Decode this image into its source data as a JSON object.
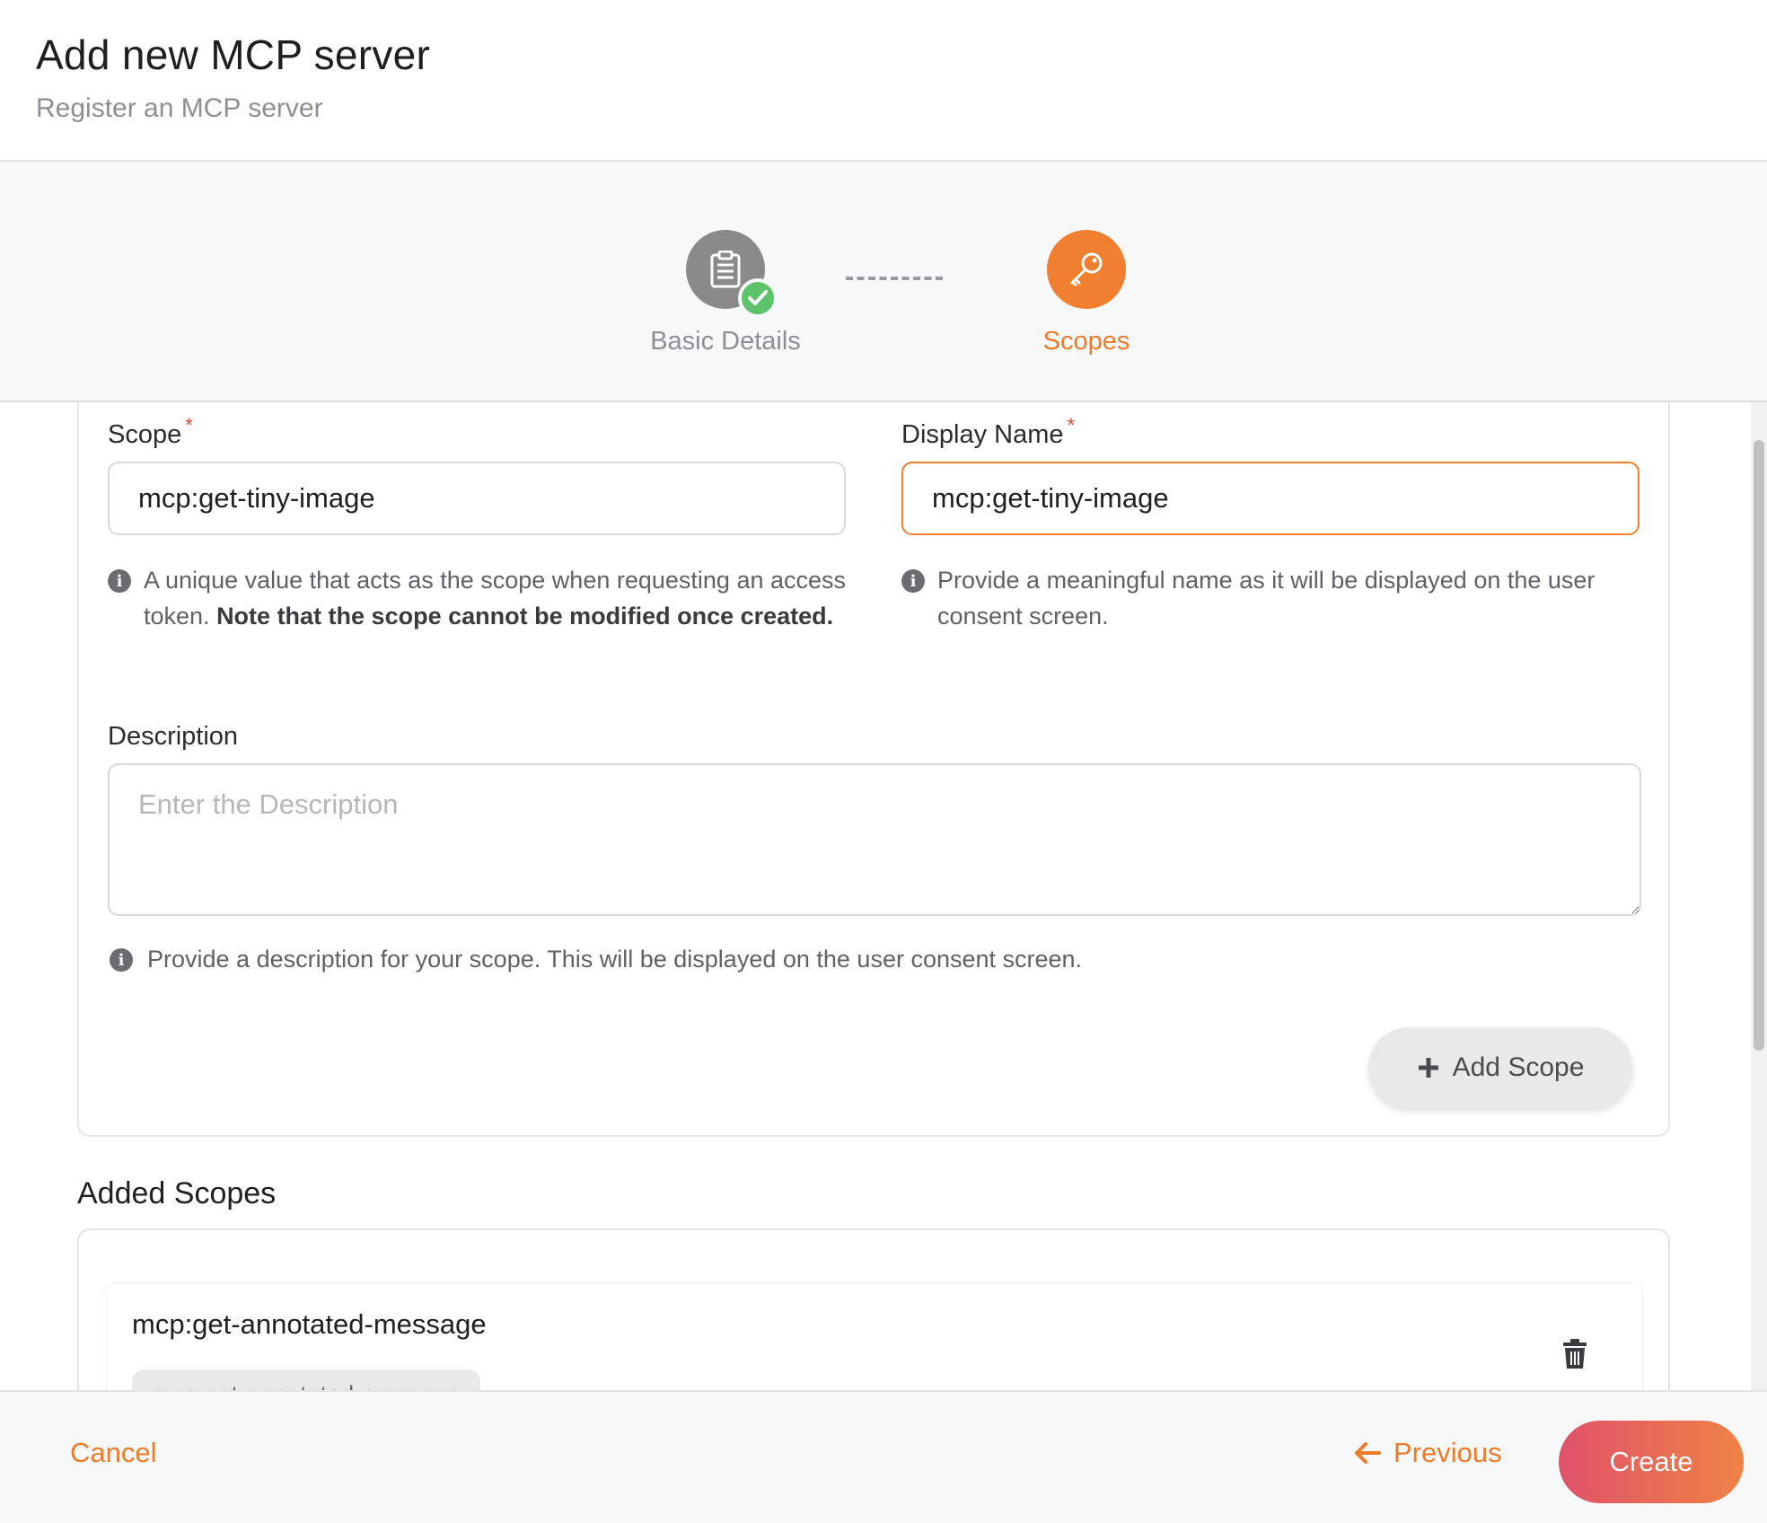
{
  "header": {
    "title": "Add new MCP server",
    "subtitle": "Register an MCP server"
  },
  "stepper": {
    "steps": [
      {
        "label": "Basic Details",
        "state": "completed",
        "icon": "clipboard-icon"
      },
      {
        "label": "Scopes",
        "state": "active",
        "icon": "key-icon"
      }
    ]
  },
  "form": {
    "scope": {
      "label": "Scope",
      "required_mark": "*",
      "value": "mcp:get-tiny-image",
      "help_text": "A unique value that acts as the scope when requesting an access token. ",
      "help_bold": "Note that the scope cannot be modified once created."
    },
    "display_name": {
      "label": "Display Name",
      "required_mark": "*",
      "value": "mcp:get-tiny-image",
      "help_text": "Provide a meaningful name as it will be displayed on the user consent screen."
    },
    "description": {
      "label": "Description",
      "placeholder": "Enter the Description",
      "value": "",
      "help_text": "Provide a description for your scope. This will be displayed on the user consent screen."
    },
    "add_scope_label": "Add Scope"
  },
  "added_scopes": {
    "heading": "Added Scopes",
    "items": [
      {
        "name": "mcp:get-annotated-message",
        "display_name": "mcp:get-annotated-message"
      }
    ]
  },
  "footer": {
    "cancel_label": "Cancel",
    "previous_label": "Previous",
    "create_label": "Create"
  },
  "colors": {
    "accent": "#f07f2f",
    "success": "#5dc36a",
    "required": "#e0453a",
    "create_gradient_start": "#e0526a",
    "create_gradient_end": "#ef8245"
  }
}
